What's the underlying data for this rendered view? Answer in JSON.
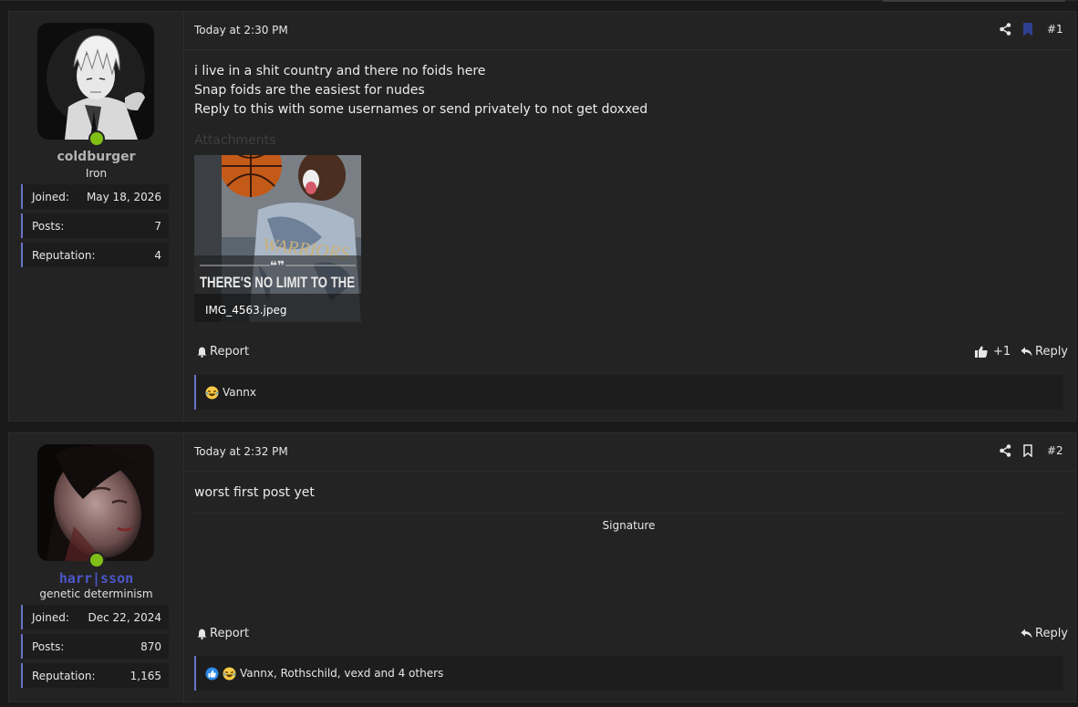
{
  "posts": [
    {
      "username": "coldburger",
      "user_title": "Iron",
      "stats": [
        {
          "label": "Joined:",
          "value": "May 18, 2026"
        },
        {
          "label": "Posts:",
          "value": "7"
        },
        {
          "label": "Reputation:",
          "value": "4"
        }
      ],
      "date": "Today at 2:30 PM",
      "post_number": "#1",
      "bookmarked": true,
      "body_lines": [
        "i live in a shit country and there no foids here",
        "Snap foids are the easiest for nudes",
        "Reply to this with some usernames or send privately to not get doxxed"
      ],
      "attachments_label": "Attachments",
      "attachment": {
        "caption_text": "THERE'S NO LIMIT TO THE",
        "shirt_text": "WARRIORS",
        "filename": "IMG_4563.jpeg"
      },
      "report_label": "Report",
      "like_count": "+1",
      "reply_label": "Reply",
      "reactions_text": "Vannx"
    },
    {
      "username": "harr|sson",
      "user_title": "genetic determinism",
      "stats": [
        {
          "label": "Joined:",
          "value": "Dec 22, 2024"
        },
        {
          "label": "Posts:",
          "value": "870"
        },
        {
          "label": "Reputation:",
          "value": "1,165"
        }
      ],
      "date": "Today at 2:32 PM",
      "post_number": "#2",
      "bookmarked": false,
      "body_lines": [
        "worst first post yet"
      ],
      "signature_label": "Signature",
      "report_label": "Report",
      "reply_label": "Reply",
      "reactions_text": "Vannx, Rothschild, vexd and 4 others"
    }
  ],
  "colors": {
    "accent": "#6a73c8",
    "username_1": "#b3b3b3",
    "username_2": "#4b57c8",
    "online": "#7fbf16",
    "bookmark_active": "#2f3f8f"
  }
}
